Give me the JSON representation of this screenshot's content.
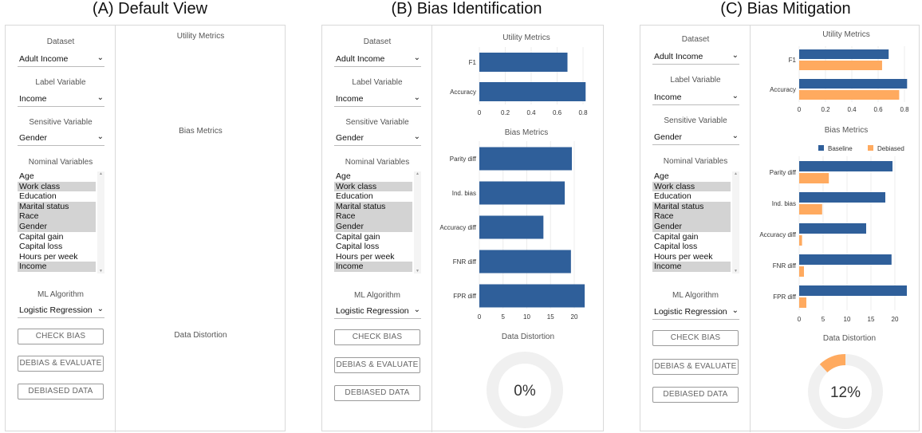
{
  "panels": [
    {
      "title": "(A) Default View"
    },
    {
      "title": "(B) Bias Identification"
    },
    {
      "title": "(C) Bias Mitigation"
    }
  ],
  "controls": {
    "dataset_label": "Dataset",
    "dataset_value": "Adult Income",
    "label_variable_label": "Label Variable",
    "label_variable_value": "Income",
    "sensitive_label": "Sensitive Variable",
    "sensitive_value": "Gender",
    "nominal_label": "Nominal Variables",
    "nominal_items": [
      {
        "label": "Age",
        "selected": false
      },
      {
        "label": "Work class",
        "selected": true
      },
      {
        "label": "Education",
        "selected": false
      },
      {
        "label": "Marital status",
        "selected": true
      },
      {
        "label": "Race",
        "selected": true
      },
      {
        "label": "Gender",
        "selected": true
      },
      {
        "label": "Capital gain",
        "selected": false
      },
      {
        "label": "Capital loss",
        "selected": false
      },
      {
        "label": "Hours per week",
        "selected": false
      },
      {
        "label": "Income",
        "selected": true
      }
    ],
    "ml_label": "ML Algorithm",
    "ml_value": "Logistic Regression",
    "check_bias": "CHECK BIAS",
    "debias_evaluate": "DEBIAS & EVALUATE",
    "debiased_data": "DEBIASED DATA"
  },
  "sections": {
    "utility": "Utility Metrics",
    "bias": "Bias Metrics",
    "distortion": "Data Distortion"
  },
  "colors": {
    "baseline": "#2f5f9a",
    "debiased": "#ffaa5f",
    "donut_track": "#f0f0f0"
  },
  "chart_data": [
    {
      "id": "B-utility",
      "type": "bar",
      "title": "Utility Metrics",
      "categories": [
        "F1",
        "Accuracy"
      ],
      "series": [
        {
          "name": "",
          "values": [
            0.68,
            0.82
          ]
        }
      ],
      "xlim": [
        0,
        0.8
      ],
      "ticks": [
        "0",
        "0.2",
        "0.4",
        "0.6",
        "0.8"
      ],
      "tick_values": [
        0,
        0.2,
        0.4,
        0.6,
        0.8
      ]
    },
    {
      "id": "B-bias",
      "type": "bar",
      "title": "Bias Metrics",
      "categories": [
        "Parity diff",
        "Ind. bias",
        "Accuracy diff",
        "FNR diff",
        "FPR diff"
      ],
      "series": [
        {
          "name": "",
          "values": [
            19.5,
            18.0,
            13.5,
            19.3,
            22.2
          ]
        }
      ],
      "xlim": [
        0,
        20
      ],
      "ticks": [
        "0",
        "5",
        "10",
        "15",
        "20"
      ],
      "tick_values": [
        0,
        5,
        10,
        15,
        20
      ]
    },
    {
      "id": "B-distortion",
      "type": "pie",
      "title": "Data Distortion",
      "value": 0,
      "label": "0%"
    },
    {
      "id": "C-utility",
      "type": "bar",
      "title": "Utility Metrics",
      "categories": [
        "F1",
        "Accuracy"
      ],
      "series": [
        {
          "name": "Baseline",
          "values": [
            0.68,
            0.82
          ]
        },
        {
          "name": "Debiased",
          "values": [
            0.63,
            0.76
          ]
        }
      ],
      "xlim": [
        0,
        0.8
      ],
      "ticks": [
        "0",
        "0.2",
        "0.4",
        "0.6",
        "0.8"
      ],
      "tick_values": [
        0,
        0.2,
        0.4,
        0.6,
        0.8
      ]
    },
    {
      "id": "C-bias",
      "type": "bar",
      "title": "Bias Metrics",
      "legend": "top-right",
      "categories": [
        "Parity diff",
        "Ind. bias",
        "Accuracy diff",
        "FNR diff",
        "FPR diff"
      ],
      "series": [
        {
          "name": "Baseline",
          "values": [
            19.5,
            18.0,
            14.0,
            19.3,
            22.5
          ]
        },
        {
          "name": "Debiased",
          "values": [
            6.2,
            4.8,
            0.6,
            1.0,
            1.5
          ]
        }
      ],
      "xlim": [
        0,
        20
      ],
      "ticks": [
        "0",
        "5",
        "10",
        "15",
        "20"
      ],
      "tick_values": [
        0,
        5,
        10,
        15,
        20
      ]
    },
    {
      "id": "C-distortion",
      "type": "pie",
      "title": "Data Distortion",
      "value": 12,
      "label": "12%"
    }
  ]
}
